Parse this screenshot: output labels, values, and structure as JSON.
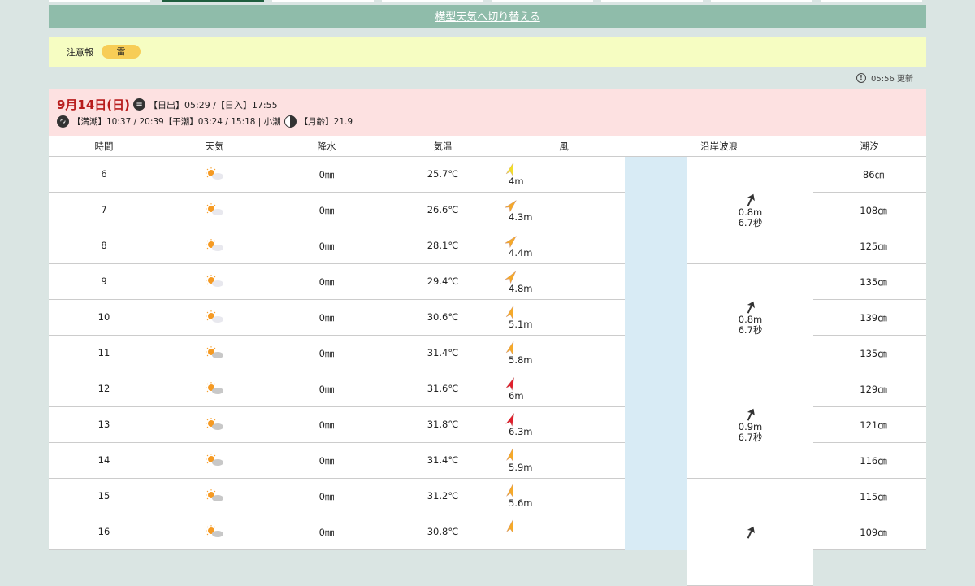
{
  "switch_label": "横型天気へ切り替える",
  "warning": {
    "label": "注意報",
    "badge": "雷"
  },
  "updated": "05:56 更新",
  "day": {
    "date": "9月14日(日)",
    "sun": "【日出】05:29 /【日入】17:55",
    "tide": "【満潮】10:37 / 20:39【干潮】03:24 / 15:18 | 小潮",
    "moon": "【月齢】21.9"
  },
  "headers": [
    "時間",
    "天気",
    "降水",
    "気温",
    "風",
    "沿岸波浪",
    "潮汐"
  ],
  "colors": {
    "yellow": "#f2dd2a",
    "orange": "#f5a92a",
    "red": "#e01f2c"
  },
  "rows": [
    {
      "hour": "6",
      "weather": "sunny-cloudy",
      "rain": "0㎜",
      "temp": "25.7℃",
      "wind": "4m",
      "wdir": 20,
      "wcol": "yellow",
      "tide": "86㎝"
    },
    {
      "hour": "7",
      "weather": "sunny-cloudy",
      "rain": "0㎜",
      "temp": "26.6℃",
      "wind": "4.3m",
      "wdir": 45,
      "wcol": "orange",
      "tide": "108㎝"
    },
    {
      "hour": "8",
      "weather": "sunny-cloudy",
      "rain": "0㎜",
      "temp": "28.1℃",
      "wind": "4.4m",
      "wdir": 45,
      "wcol": "orange",
      "tide": "125㎝"
    },
    {
      "hour": "9",
      "weather": "sunny-cloudy",
      "rain": "0㎜",
      "temp": "29.4℃",
      "wind": "4.8m",
      "wdir": 40,
      "wcol": "orange",
      "tide": "135㎝"
    },
    {
      "hour": "10",
      "weather": "sunny-cloudy",
      "rain": "0㎜",
      "temp": "30.6℃",
      "wind": "5.1m",
      "wdir": 20,
      "wcol": "orange",
      "tide": "139㎝"
    },
    {
      "hour": "11",
      "weather": "sunny-cloudy",
      "rain": "0㎜",
      "temp": "31.4℃",
      "wind": "5.8m",
      "wdir": 20,
      "wcol": "orange",
      "tide": "135㎝"
    },
    {
      "hour": "12",
      "weather": "sunny-cloudy",
      "rain": "0㎜",
      "temp": "31.6℃",
      "wind": "6m",
      "wdir": 25,
      "wcol": "red",
      "tide": "129㎝"
    },
    {
      "hour": "13",
      "weather": "sunny-cloudy",
      "rain": "0㎜",
      "temp": "31.8℃",
      "wind": "6.3m",
      "wdir": 25,
      "wcol": "red",
      "tide": "121㎝"
    },
    {
      "hour": "14",
      "weather": "sunny-cloudy",
      "rain": "0㎜",
      "temp": "31.4℃",
      "wind": "5.9m",
      "wdir": 15,
      "wcol": "orange",
      "tide": "116㎝"
    },
    {
      "hour": "15",
      "weather": "sunny-cloudy",
      "rain": "0㎜",
      "temp": "31.2℃",
      "wind": "5.6m",
      "wdir": 15,
      "wcol": "orange",
      "tide": "115㎝"
    },
    {
      "hour": "16",
      "weather": "sunny-cloudy",
      "rain": "0㎜",
      "temp": "30.8℃",
      "wind": "",
      "wdir": 15,
      "wcol": "orange",
      "tide": "109㎝"
    }
  ],
  "waves": [
    {
      "height": "0.8m",
      "period": "6.7秒",
      "dir": 25
    },
    {
      "height": "0.8m",
      "period": "6.7秒",
      "dir": 25
    },
    {
      "height": "0.9m",
      "period": "6.7秒",
      "dir": 25
    },
    {
      "height": "",
      "period": "",
      "dir": 25
    }
  ]
}
